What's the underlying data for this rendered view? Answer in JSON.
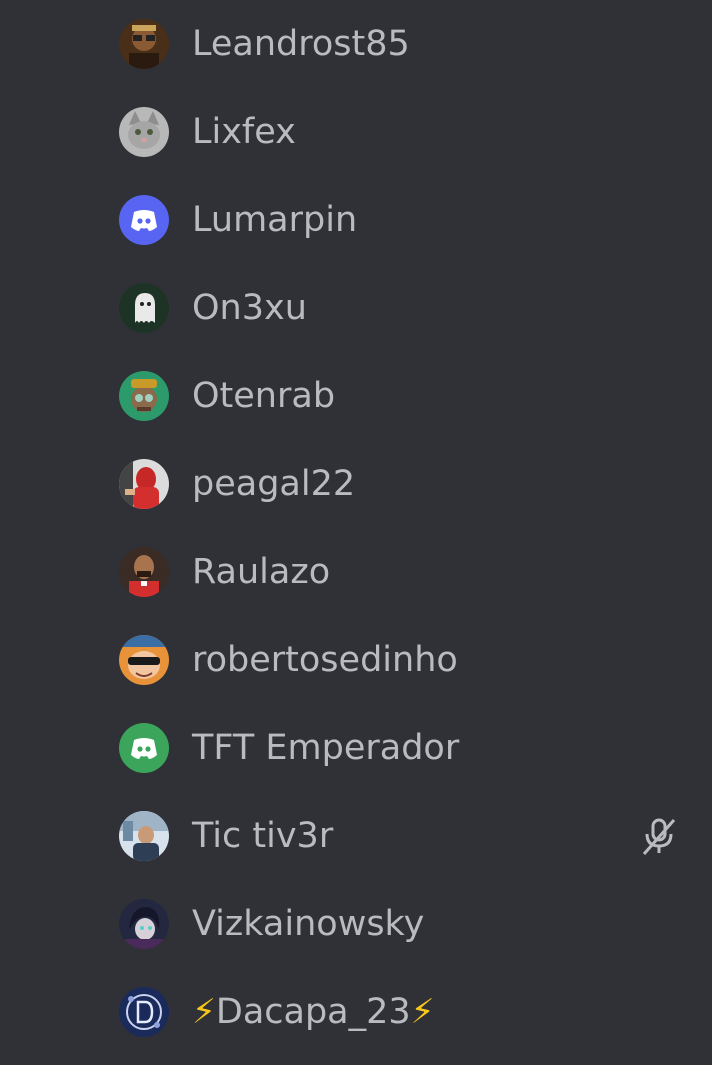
{
  "members": [
    {
      "name": "Leandrost85",
      "avatar_icon": "user-photo-icon",
      "avatar_color": "#5a3a1e"
    },
    {
      "name": "Lixfex",
      "avatar_icon": "cat-photo-icon",
      "avatar_color": "#9a9a9a"
    },
    {
      "name": "Lumarpin",
      "avatar_icon": "discord-logo-icon",
      "avatar_color": "#5865f2"
    },
    {
      "name": "On3xu",
      "avatar_icon": "ghost-photo-icon",
      "avatar_color": "#1f3a2a"
    },
    {
      "name": "Otenrab",
      "avatar_icon": "character-photo-icon",
      "avatar_color": "#2e8b57"
    },
    {
      "name": "peagal22",
      "avatar_icon": "user-photo-icon",
      "avatar_color": "#c0392b"
    },
    {
      "name": "Raulazo",
      "avatar_icon": "user-photo-icon",
      "avatar_color": "#3a2a22"
    },
    {
      "name": "robertosedinho",
      "avatar_icon": "cartoon-photo-icon",
      "avatar_color": "#e08a2c"
    },
    {
      "name": "TFT Emperador",
      "avatar_icon": "discord-logo-icon",
      "avatar_color": "#3ba55c"
    },
    {
      "name": "Tic tiv3r",
      "avatar_icon": "user-photo-icon",
      "avatar_color": "#7f9bb3",
      "muted": true
    },
    {
      "name": "Vizkainowsky",
      "avatar_icon": "anime-photo-icon",
      "avatar_color": "#2a2d4a"
    },
    {
      "name": "Dacapa_23",
      "prefix": "⚡",
      "suffix": "⚡",
      "avatar_icon": "emblem-photo-icon",
      "avatar_color": "#1b2a5e"
    }
  ],
  "colors": {
    "background": "#2f3136",
    "name_text": "#b9bbbe",
    "bolt": "#f7c81b",
    "mute_icon": "#b9bbbe"
  }
}
